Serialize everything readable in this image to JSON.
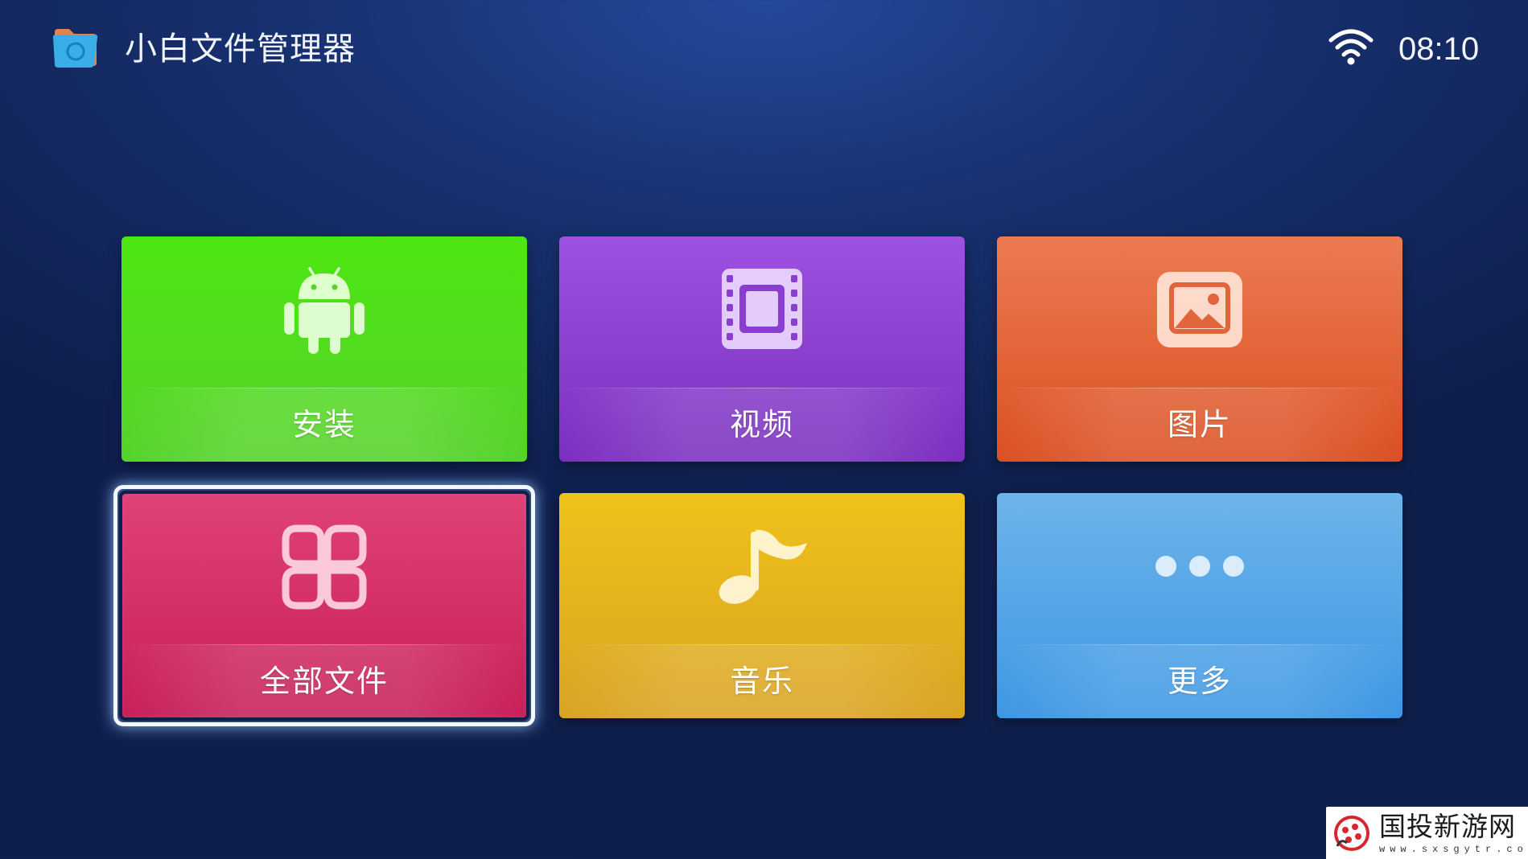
{
  "header": {
    "app_title": "小白文件管理器",
    "app_icon": "folder-icon",
    "status_icon": "wifi-icon",
    "time": "08:10"
  },
  "tiles": [
    {
      "label": "安装",
      "icon": "android-icon",
      "color": "#4de612"
    },
    {
      "label": "视频",
      "icon": "film-icon",
      "color": "#9e52e2"
    },
    {
      "label": "图片",
      "icon": "image-icon",
      "color": "#ec7a52"
    },
    {
      "label": "全部文件",
      "icon": "grid-icon",
      "color": "#e04276",
      "focused": true
    },
    {
      "label": "音乐",
      "icon": "music-note-icon",
      "color": "#efc21a"
    },
    {
      "label": "更多",
      "icon": "more-icon",
      "color": "#6db4ea"
    }
  ],
  "watermark": {
    "text": "国投新游网",
    "url": "www.sxsgytr.com"
  }
}
